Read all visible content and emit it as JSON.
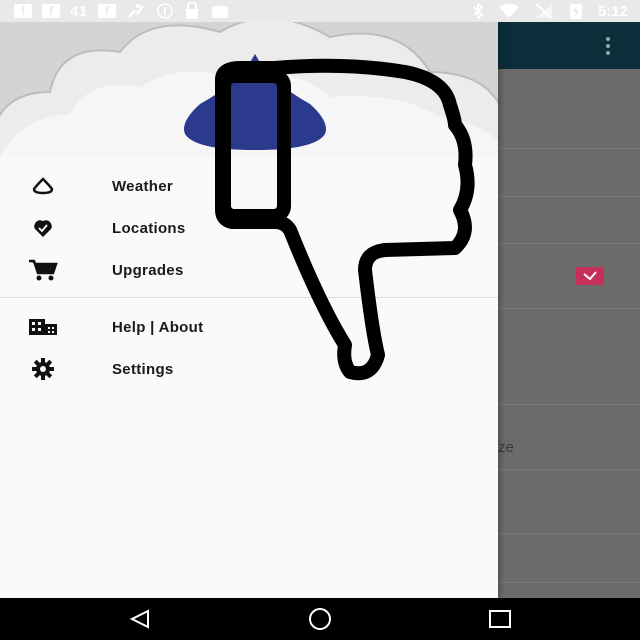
{
  "status_bar": {
    "notification_count": "41",
    "time": "5:12"
  },
  "drawer": {
    "primary_items": [
      {
        "label": "Weather",
        "icon": "drop-icon"
      },
      {
        "label": "Locations",
        "icon": "location-pin-icon"
      },
      {
        "label": "Upgrades",
        "icon": "cart-icon"
      }
    ],
    "secondary_items": [
      {
        "label": "Help | About",
        "icon": "building-icon"
      },
      {
        "label": "Settings",
        "icon": "gear-icon"
      }
    ]
  },
  "background": {
    "partial_text": "ze"
  },
  "colors": {
    "toolbar": "#0c2e3a",
    "accent": "#c4305a",
    "drop": "#2b3a8c"
  }
}
